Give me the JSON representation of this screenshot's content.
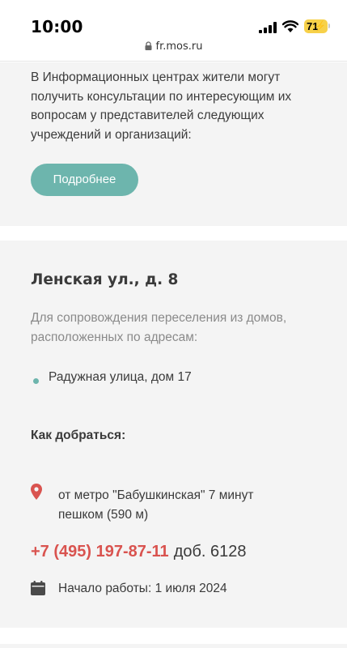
{
  "status_bar": {
    "time": "10:00",
    "battery": "71",
    "url": "fr.mos.ru"
  },
  "intro": {
    "text": "В Информационных центрах жители могут получить консультации по интересующим их вопросам у представителей следующих учреждений и организаций:",
    "button_label": "Подробнее"
  },
  "location": {
    "title": "Ленская ул., д. 8",
    "purpose": "Для сопровождения переселения из домов, расположенных по адресам:",
    "addresses": [
      "Радужная улица, дом 17"
    ],
    "howto_label": "Как добраться:",
    "metro": "от метро \"Бабушкинская\" 7 минут пешком (590 м)",
    "phone": "+7 (495) 197-87-11",
    "extension": "доб. 6128",
    "start": "Начало работы: 1 июля 2024"
  },
  "colors": {
    "accent": "#6db5ad",
    "phone": "#d9534f",
    "battery": "#f7d14a"
  },
  "icons": {
    "pin": "map-pin-icon",
    "calendar": "calendar-icon"
  }
}
